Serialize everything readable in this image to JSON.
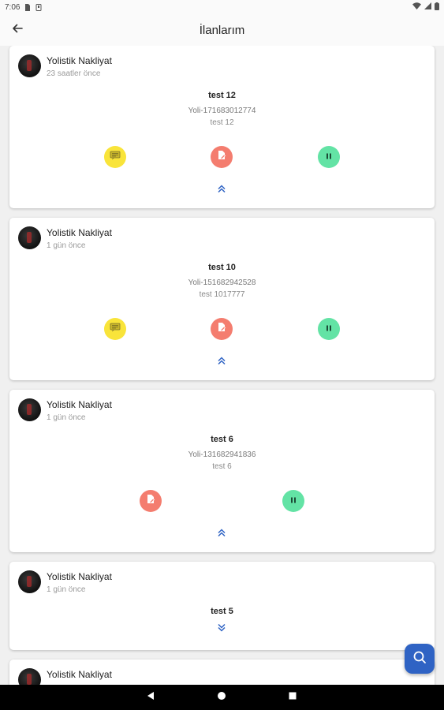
{
  "status_bar": {
    "time": "7:06"
  },
  "app_bar": {
    "title": "İlanlarım"
  },
  "cards": [
    {
      "company": "Yolistik Nakliyat",
      "time": "23 saatler önce",
      "title": "test 12",
      "code": "Yoli-171683012774",
      "description": "test 12"
    },
    {
      "company": "Yolistik Nakliyat",
      "time": "1 gün önce",
      "title": "test 10",
      "code": "Yoli-151682942528",
      "description": "test 1017777"
    },
    {
      "company": "Yolistik Nakliyat",
      "time": "1 gün önce",
      "title": "test 6",
      "code": "Yoli-131682941836",
      "description": "test 6"
    },
    {
      "company": "Yolistik Nakliyat",
      "time": "1 gün önce",
      "title": "test 5"
    },
    {
      "company": "Yolistik Nakliyat"
    }
  ],
  "icons": {
    "back": "arrow-left-icon",
    "message": "message-icon",
    "edit": "edit-document-icon",
    "pause": "pause-icon",
    "collapse": "chevron-double-up-icon",
    "expand": "chevron-double-down-icon",
    "search": "search-icon"
  },
  "colors": {
    "message_button": "#f9e43a",
    "edit_button": "#f47d6f",
    "pause_button": "#63e3a5",
    "chevron": "#2f63c4",
    "fab": "#2f63c4"
  }
}
